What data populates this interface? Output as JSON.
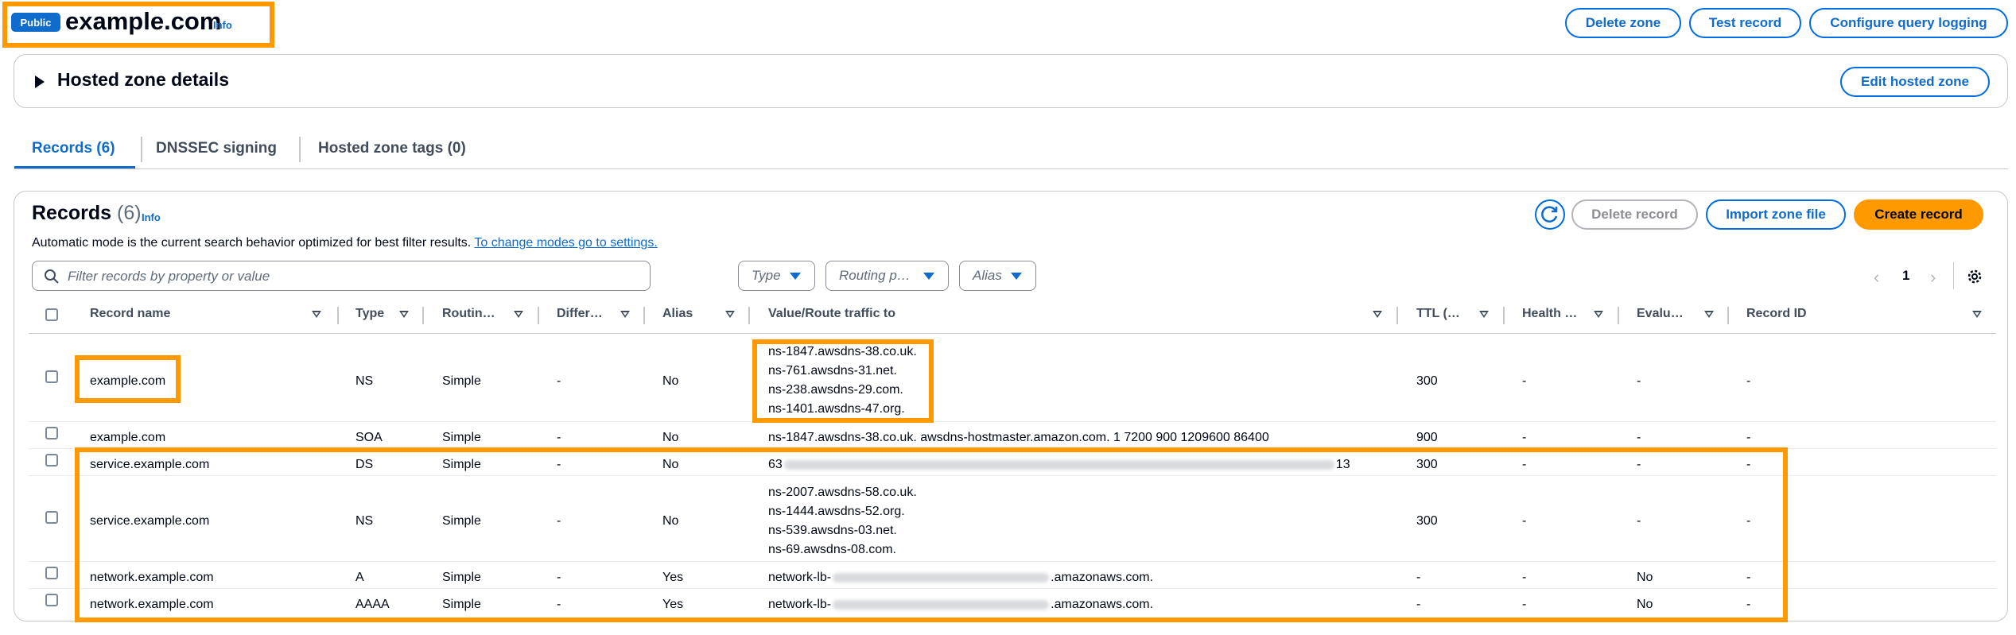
{
  "header": {
    "badge": "Public",
    "title": "example.com",
    "info": "Info",
    "buttons": {
      "delete_zone": "Delete zone",
      "test_record": "Test record",
      "configure_logging": "Configure query logging"
    }
  },
  "details": {
    "title": "Hosted zone details",
    "edit_button": "Edit hosted zone"
  },
  "tabs": [
    {
      "label": "Records (6)",
      "active": true
    },
    {
      "label": "DNSSEC signing"
    },
    {
      "label": "Hosted zone tags (0)"
    }
  ],
  "records_panel": {
    "title": "Records",
    "count": "(6)",
    "info": "Info",
    "description": "Automatic mode is the current search behavior optimized for best filter results.",
    "settings_link": "To change modes go to settings.",
    "buttons": {
      "delete": "Delete record",
      "import": "Import zone file",
      "create": "Create record"
    },
    "search_placeholder": "Filter records by property or value",
    "filters": {
      "type": "Type",
      "routing": "Routing p…",
      "alias": "Alias"
    },
    "pagination": {
      "page": "1"
    }
  },
  "table": {
    "columns": [
      "Record name",
      "Type",
      "Routin…",
      "Differ…",
      "Alias",
      "Value/Route traffic to",
      "TTL (…",
      "Health …",
      "Evalu…",
      "Record ID"
    ],
    "rows": [
      {
        "name": "example.com",
        "type": "NS",
        "routing": "Simple",
        "differ": "-",
        "alias": "No",
        "values": [
          "ns-1847.awsdns-38.co.uk.",
          "ns-761.awsdns-31.net.",
          "ns-238.awsdns-29.com.",
          "ns-1401.awsdns-47.org."
        ],
        "ttl": "300",
        "health": "-",
        "eval": "-",
        "id": "-"
      },
      {
        "name": "example.com",
        "type": "SOA",
        "routing": "Simple",
        "differ": "-",
        "alias": "No",
        "values": [
          "ns-1847.awsdns-38.co.uk. awsdns-hostmaster.amazon.com. 1 7200 900 1209600 86400"
        ],
        "ttl": "900",
        "health": "-",
        "eval": "-",
        "id": "-"
      },
      {
        "name": "service.example.com",
        "type": "DS",
        "routing": "Simple",
        "differ": "-",
        "alias": "No",
        "value_prefix": "63",
        "value_suffix": "13",
        "ttl": "300",
        "health": "-",
        "eval": "-",
        "id": "-"
      },
      {
        "name": "service.example.com",
        "type": "NS",
        "routing": "Simple",
        "differ": "-",
        "alias": "No",
        "values": [
          "ns-2007.awsdns-58.co.uk.",
          "ns-1444.awsdns-52.org.",
          "ns-539.awsdns-03.net.",
          "ns-69.awsdns-08.com."
        ],
        "ttl": "300",
        "health": "-",
        "eval": "-",
        "id": "-"
      },
      {
        "name": "network.example.com",
        "type": "A",
        "routing": "Simple",
        "differ": "-",
        "alias": "Yes",
        "value_prefix": "network-lb-",
        "value_suffix": ".amazonaws.com.",
        "ttl": "-",
        "health": "-",
        "eval": "No",
        "id": "-"
      },
      {
        "name": "network.example.com",
        "type": "AAAA",
        "routing": "Simple",
        "differ": "-",
        "alias": "Yes",
        "value_prefix": "network-lb-",
        "value_suffix": ".amazonaws.com.",
        "ttl": "-",
        "health": "-",
        "eval": "No",
        "id": "-"
      }
    ]
  },
  "colors": {
    "accent": "#0f6bcc",
    "highlight": "#ff9900",
    "badge": "#0f6bcc"
  }
}
